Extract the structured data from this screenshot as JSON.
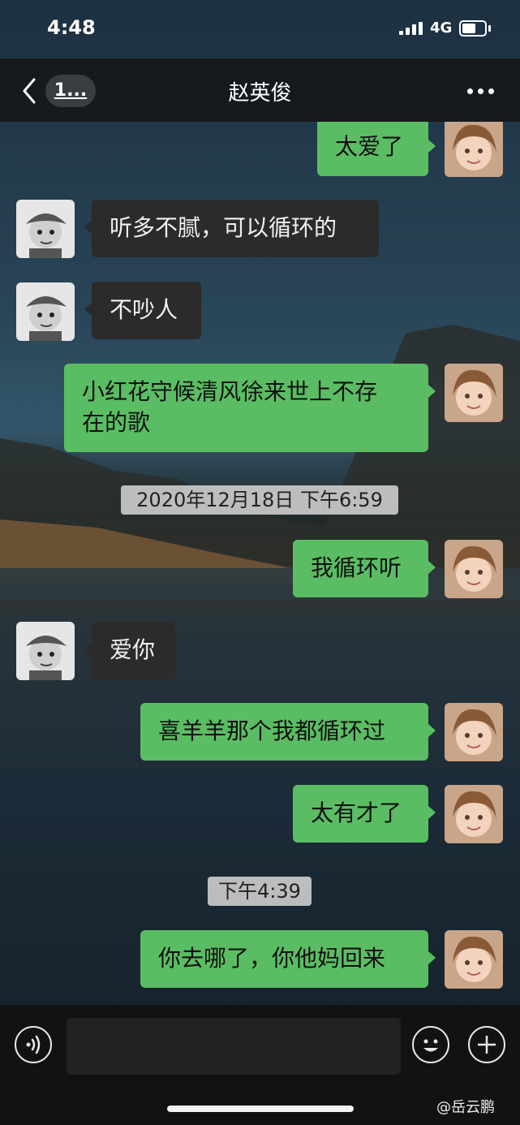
{
  "status_bar": {
    "time": "4:48",
    "network": "4G"
  },
  "nav": {
    "back_label": "1...",
    "title": "赵英俊"
  },
  "messages": [
    {
      "side": "out",
      "text": "太爱了"
    },
    {
      "side": "in",
      "text": "听多不腻，可以循环的"
    },
    {
      "side": "in",
      "text": "不吵人"
    },
    {
      "side": "out",
      "lines": [
        "小红花守候清风徐来世上不存",
        "在的歌"
      ]
    },
    {
      "type": "timestamp",
      "text": "2020年12月18日 下午6:59"
    },
    {
      "side": "out",
      "text": "我循环听"
    },
    {
      "side": "in",
      "text": "爱你"
    },
    {
      "side": "out",
      "text": "喜羊羊那个我都循环过"
    },
    {
      "side": "out",
      "text": "太有才了"
    },
    {
      "type": "timestamp",
      "text": "下午4:39"
    },
    {
      "side": "out",
      "text": "你去哪了，你他妈回来"
    }
  ],
  "input_bar": {
    "icons": [
      "voice-icon",
      "emoji-icon",
      "plus-icon"
    ]
  },
  "watermark": "@岳云鹏",
  "colors": {
    "outgoing_bubble": "#5bbd63",
    "incoming_bubble": "#2b2b2b",
    "nav_bg": "#16181a"
  }
}
